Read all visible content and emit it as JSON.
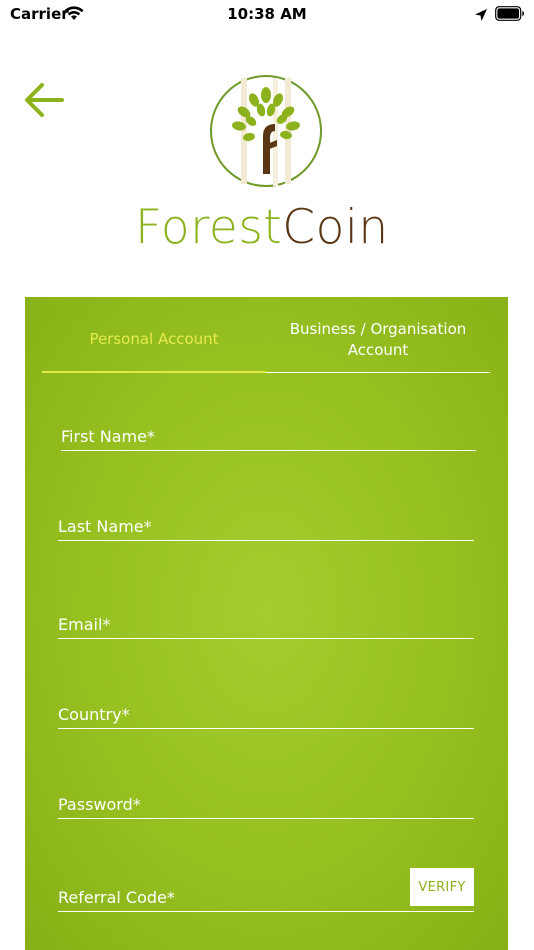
{
  "status_bar": {
    "carrier": "Carrier",
    "time": "10:38 AM",
    "icons": [
      "wifi-icon",
      "location-arrow-icon",
      "battery-icon"
    ]
  },
  "header": {
    "back_icon": "arrow-left-icon",
    "logo_text_forest": "Forest",
    "logo_text_coin": "Coin"
  },
  "colors": {
    "brand_green": "#8cb21e",
    "brand_brown": "#5b3615",
    "panel_green": "#9bc424",
    "active_tab": "#e6eb4a"
  },
  "tabs": [
    {
      "label": "Personal Account",
      "active": true
    },
    {
      "label": "Business / Organisation Account",
      "active": false
    }
  ],
  "form": {
    "first_name": {
      "placeholder": "First Name*",
      "value": ""
    },
    "last_name": {
      "placeholder": "Last Name*",
      "value": ""
    },
    "email": {
      "placeholder": "Email*",
      "value": ""
    },
    "country": {
      "placeholder": "Country*",
      "value": ""
    },
    "password": {
      "placeholder": "Password*",
      "value": ""
    },
    "referral_code": {
      "placeholder": "Referral Code*",
      "value": ""
    },
    "verify_label": "VERIFY"
  }
}
